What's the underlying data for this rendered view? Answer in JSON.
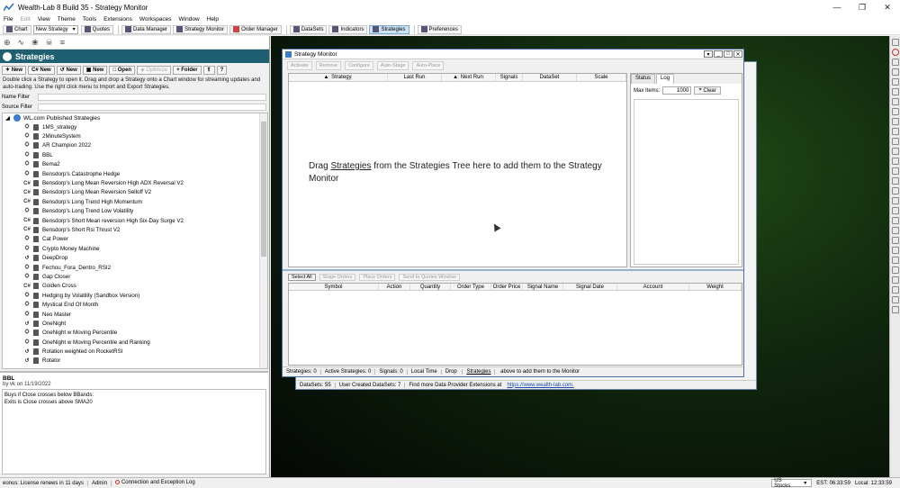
{
  "window": {
    "title": "Wealth-Lab 8 Build 35 - Strategy Monitor"
  },
  "menu": [
    "File",
    "Edit",
    "View",
    "Theme",
    "Tools",
    "Extensions",
    "Workspaces",
    "Window",
    "Help"
  ],
  "toolbar": {
    "chart": "Chart",
    "new_strategy": "New Strategy",
    "quotes": "Quotes",
    "data_manager": "Data Manager",
    "strategy_monitor": "Strategy Monitor",
    "order_manager": "Order Manager",
    "datasets": "DataSets",
    "indicators": "Indicators",
    "strategies": "Strategies",
    "preferences": "Preferences"
  },
  "left": {
    "header": "Strategies",
    "buttons": {
      "new1": "New",
      "new2": "New",
      "new3": "New",
      "new4": "New",
      "open": "Open",
      "optimize": "Optimize",
      "folder": "Folder"
    },
    "help_text": "Double click a Strategy to open it. Drag and drop a Strategy onto a Chart window for streaming updates and auto-trading. Use the right click menu to Import and Export Strategies.",
    "name_filter": "Name Filter",
    "source_filter": "Source Filter",
    "tree_root": "WL.com Published Strategies",
    "items": [
      {
        "kind": "&#x26ED;",
        "label": "1MS_strategy"
      },
      {
        "kind": "&#x26ED;",
        "label": "2MinuteSystem"
      },
      {
        "kind": "&#x26ED;",
        "label": "AR Champion 2022"
      },
      {
        "kind": "&#x26ED;",
        "label": "BBL"
      },
      {
        "kind": "&#x26ED;",
        "label": "Bema2"
      },
      {
        "kind": "&#x26ED;",
        "label": "Bensdorp's Catastrophe Hedge"
      },
      {
        "kind": "C#",
        "label": "Bensdorp's Long Mean Reversion High ADX Reversal V2"
      },
      {
        "kind": "C#",
        "label": "Bensdorp's Long Mean Reversion Selloff V2"
      },
      {
        "kind": "C#",
        "label": "Bensdorp's Long Trend High Momentum"
      },
      {
        "kind": "&#x26ED;",
        "label": "Bensdorp's Long Trend Low Volatility"
      },
      {
        "kind": "C#",
        "label": "Bensdorp's Short Mean reversion High Six-Day Surge V2"
      },
      {
        "kind": "C#",
        "label": "Bensdorp's Short Rsi Thrust V2"
      },
      {
        "kind": "&#x26ED;",
        "label": "Cat Power"
      },
      {
        "kind": "&#x26ED;",
        "label": "Crypto Money Machine"
      },
      {
        "kind": "&#x21BA;",
        "label": "DeepDrop"
      },
      {
        "kind": "&#x26ED;",
        "label": "Fechou_Fora_Dentro_RSI2"
      },
      {
        "kind": "&#x26ED;",
        "label": "Gap Closer"
      },
      {
        "kind": "C#",
        "label": "Golden Cross"
      },
      {
        "kind": "&#x26ED;",
        "label": "Hedging by Volatility (Sandbox Version)"
      },
      {
        "kind": "&#x26ED;",
        "label": "Mystical End Of Month"
      },
      {
        "kind": "&#x26ED;",
        "label": "Neo Master"
      },
      {
        "kind": "&#x21BA;",
        "label": "OneNight"
      },
      {
        "kind": "&#x26ED;",
        "label": "OneNight w Moving Percentile"
      },
      {
        "kind": "&#x26ED;",
        "label": "OneNight w Moving Percentile and Ranking"
      },
      {
        "kind": "&#x21BA;",
        "label": "Rotation weighted on RocketRSI"
      },
      {
        "kind": "&#x21BA;",
        "label": "Rotator"
      }
    ],
    "selected": {
      "name": "BBL",
      "by": "by vk on 11/19/2022",
      "line1": "Buys if Close crosses below BBands.",
      "line2": "Exits is Close crosses above SMA20"
    }
  },
  "bgwin": {
    "status": [
      "DataSets: 55",
      "User Created DataSets: 7",
      "Find more Data Provider Extensions at"
    ],
    "link": "https://www.wealth-lab.com."
  },
  "monitor": {
    "title": "Strategy Monitor",
    "toolbar": [
      "Activate",
      "Remove",
      "Configure",
      "Auto-Stage",
      "Auto-Place"
    ],
    "columns": [
      "Strategy",
      "Last Run",
      "Next Run",
      "Signals",
      "DataSet",
      "Scale"
    ],
    "drag_hint_pre": "Drag ",
    "drag_hint_link": "Strategies",
    "drag_hint_post": " from the Strategies Tree here to add them to the Strategy Monitor",
    "tabs": [
      "Status",
      "Log"
    ],
    "max_items_label": "Max Items:",
    "max_items": "1000",
    "clear": "Clear",
    "orders_buttons": [
      "Select All",
      "Stage Orders",
      "Place Orders",
      "Send to Quotes Window"
    ],
    "order_columns": [
      "Symbol",
      "Action",
      "Quantity",
      "Order Type",
      "Order Price",
      "Signal Name",
      "Signal Date",
      "Account",
      "Weight"
    ],
    "status": {
      "strategies": "Strategies: 0",
      "active": "Active Strategies: 0",
      "signals": "Signals: 0",
      "time": "Local Time",
      "hint_pre": "Drop ",
      "hint_link": "Strategies",
      "hint_post": " above to add them to the Monitor"
    }
  },
  "statusbar": {
    "license": "eonus: License renews in 11 days",
    "admin": "Admin",
    "log": "Connection and Exception Log",
    "market": "US Stocks",
    "est": "EST: 06:33:59",
    "local": "Local: 12:33:59"
  }
}
